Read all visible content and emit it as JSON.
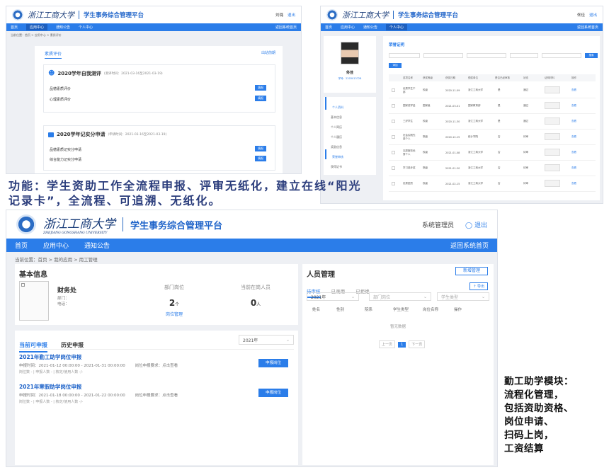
{
  "brand": {
    "university": "浙江工商大学",
    "university_en": "ZHEJIANG GONGSHANG UNIVERSITY",
    "system": "学生事务综合管理平台"
  },
  "panel1": {
    "user": "刘璐",
    "logout": "退出",
    "nav": [
      "首页",
      "应用中心",
      "通知公告",
      "个人中心"
    ],
    "back": "返回系统首页",
    "breadcrumb": "当前位置：首页 > 应用中心 > 素质评价",
    "page_title": "素质评价",
    "top_link": "出站前期",
    "section1": {
      "title": "2020学年自我测评",
      "meta": "(测评时间：2021-03-16至2021-03-19)",
      "items": [
        {
          "label": "品德素质评价",
          "button": "填报"
        },
        {
          "label": "心理素质评价",
          "button": "填报"
        }
      ]
    },
    "section2": {
      "title": "2020学年记实分申请",
      "meta": "(申请时间：2021-03-16至2021-03-19)",
      "items": [
        {
          "label": "品德素质记实分申请",
          "button": "填报"
        },
        {
          "label": "综合能力记实分申请",
          "button": "填报"
        }
      ]
    }
  },
  "panel2": {
    "user": "佟佳",
    "logout": "退出",
    "nav": [
      "首页",
      "应用中心",
      "通知公告",
      "个人中心"
    ],
    "back": "返回系统首页",
    "profile_name": "佟佳",
    "profile_id": "学号：2203013728",
    "menu": [
      "个人资料",
      "基本信息",
      "个人简历",
      "个人履历",
      "奖励信息",
      "荣誉审核",
      "获得证书"
    ],
    "section_title": "荣誉证明",
    "search_button": "搜索",
    "add_button": "添加",
    "columns": [
      "奖项名称",
      "获奖等级",
      "获奖日期",
      "颁奖单位",
      "是否已经审核",
      "状态",
      "证明材料",
      "操作"
    ],
    "rows": [
      {
        "name": "优秀学生干部",
        "level": "校级",
        "date": "2020-11-09",
        "org": "浙江工商大学",
        "audited": "是",
        "status": "通过",
        "action": "查看"
      },
      {
        "name": "国家奖学金",
        "level": "国家级",
        "date": "2021-03-01",
        "org": "国家教育部",
        "audited": "是",
        "status": "通过",
        "action": "查看"
      },
      {
        "name": "三好学生",
        "level": "校级",
        "date": "2020-11-30",
        "org": "浙江工商大学",
        "audited": "是",
        "status": "通过",
        "action": "查看"
      },
      {
        "name": "社会实践先进个人",
        "level": "院级",
        "date": "2020-12-15",
        "org": "统计学院",
        "audited": "否",
        "status": "待审",
        "action": "查看"
      },
      {
        "name": "志愿服务优秀个人",
        "level": "校级",
        "date": "2021-01-08",
        "org": "浙江工商大学",
        "audited": "否",
        "status": "待审",
        "action": "查看"
      },
      {
        "name": "学习进步奖",
        "level": "院级",
        "date": "2021-01-20",
        "org": "浙江工商大学",
        "audited": "否",
        "status": "待审",
        "action": "查看"
      },
      {
        "name": "优秀团员",
        "level": "校级",
        "date": "2021-02-15",
        "org": "浙江工商大学",
        "audited": "否",
        "status": "待审",
        "action": "查看"
      }
    ]
  },
  "caption_top": "功能：学生资助工作全流程申报、评审无纸化，建立在线“阳光记录卡”，全流程、可追溯、无纸化。",
  "caption_side": [
    "勤工助学模块：",
    "流程化管理，",
    "包括资助资格、",
    "岗位申请、",
    "扫码上岗，",
    "工资结算"
  ],
  "panel3": {
    "user": "系统管理员",
    "logout": "退出",
    "nav": [
      "首页",
      "应用中心",
      "通知公告"
    ],
    "back": "返回系统首页",
    "breadcrumb": "当前位置：首页 > 我的应用 > 用工管理",
    "basic_info": {
      "title": "基本信息",
      "dept_name": "财务处",
      "dept_label": "部门：",
      "phone_label": "电话：",
      "col1_title": "部门岗位",
      "col1_value": "2",
      "col1_unit": "个",
      "col1_link": "岗位管理",
      "col2_title": "当前在岗人员",
      "col2_value": "0",
      "col2_unit": "人"
    },
    "apply": {
      "tab_current": "当前可申报",
      "tab_history": "历史申报",
      "year": "2021年",
      "items": [
        {
          "title": "2021年勤工助学岗位申报",
          "time": "申报时间：2021-01-12 00:00:00 - 2021-01-31 00:00:00",
          "requirement": "岗位申报要求：点击查看",
          "stats": "岗位数 -  |  申报人数 -  |  核定/使用人数 -/-",
          "button": "申报岗位"
        },
        {
          "title": "2021年寒假助学岗位申报",
          "time": "申报时间：2021-01-18 00:00:00 - 2021-01-22 00:00:00",
          "requirement": "岗位申报要求：点击查看",
          "stats": "岗位数 -  |  申报人数 -  |  核定/使用人数 -/-",
          "button": "申报岗位"
        }
      ]
    },
    "personnel": {
      "title": "人员管理",
      "new_button": "新增管理",
      "tabs": [
        "待审核",
        "已录用",
        "已拒绝"
      ],
      "export": "导出",
      "filter_year": "2021年",
      "filter_post": "部门岗位",
      "filter_type": "学生类型",
      "columns": [
        "姓名",
        "性别",
        "院系",
        "学生类型",
        "岗位名称",
        "操作"
      ],
      "empty": "暂无数据",
      "prev": "上一页",
      "page": "1",
      "next": "下一页"
    }
  },
  "colors": {
    "primary": "#2b7de9",
    "caption": "#2b3d7c"
  }
}
